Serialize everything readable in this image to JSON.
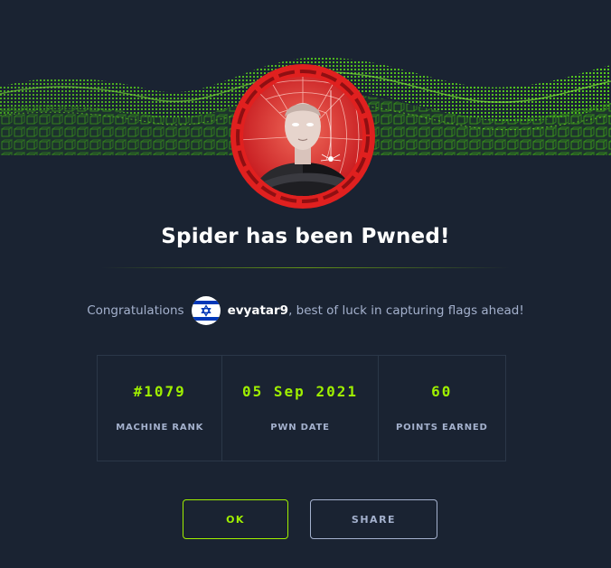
{
  "dialog": {
    "title": "Spider has been Pwned!",
    "congrats_prefix": "Congratulations",
    "username": "evyatar9",
    "congrats_suffix": ", best of luck in capturing flags ahead!"
  },
  "stats": [
    {
      "value": "#1079",
      "label": "MACHINE RANK"
    },
    {
      "value": "05 Sep 2021",
      "label": "PWN DATE"
    },
    {
      "value": "60",
      "label": "POINTS EARNED"
    }
  ],
  "buttons": {
    "ok": "OK",
    "share": "SHARE"
  },
  "colors": {
    "background": "#1a2332",
    "accent_green": "#9fef00",
    "muted_text": "#a4b1cd",
    "avatar_ring": "#e0201f"
  },
  "icons": {
    "banner": "green-wave-banner",
    "avatar": "spider-machine-avatar-icon",
    "flag": "israel-flag-icon"
  }
}
